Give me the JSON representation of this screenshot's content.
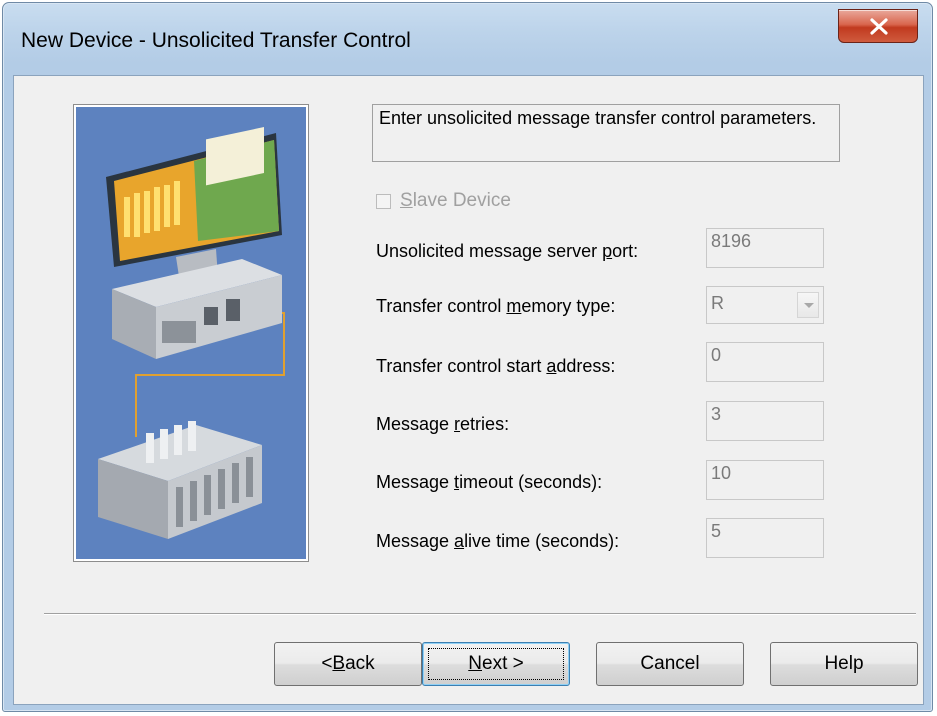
{
  "window": {
    "title": "New Device - Unsolicited Transfer Control",
    "close_icon": "close-icon",
    "close_color": "#c7432a"
  },
  "side_image": {
    "icon": "computer-plc-illustration",
    "background": "#5d82bf"
  },
  "description": "Enter unsolicited message transfer control parameters.",
  "slave_device": {
    "label_prefix": "",
    "label_mnemonic": "S",
    "label_rest": "lave Device",
    "checked": false,
    "enabled": false
  },
  "fields": [
    {
      "label_before": "Unsolicited message server ",
      "mnemonic": "p",
      "label_after": "ort:",
      "value": "8196"
    },
    {
      "label_before": "Transfer control ",
      "mnemonic": "m",
      "label_after": "emory type:",
      "value": "R",
      "options_visible": [
        "R"
      ]
    },
    {
      "label_before": "Transfer control start ",
      "mnemonic": "a",
      "label_after": "ddress:",
      "value": "0"
    },
    {
      "label_before": "Message ",
      "mnemonic": "r",
      "label_after": "etries:",
      "value": "3"
    },
    {
      "label_before": "Message ",
      "mnemonic": "t",
      "label_after": "imeout (seconds):",
      "value": "10"
    },
    {
      "label_before": "Message ",
      "mnemonic": "a",
      "label_after": "live time (seconds):",
      "value": "5"
    }
  ],
  "buttons": {
    "back_prefix": "< ",
    "back_mnemonic": "B",
    "back_rest": "ack",
    "next_mnemonic": "N",
    "next_rest": "ext >",
    "cancel": "Cancel",
    "help": "Help"
  }
}
